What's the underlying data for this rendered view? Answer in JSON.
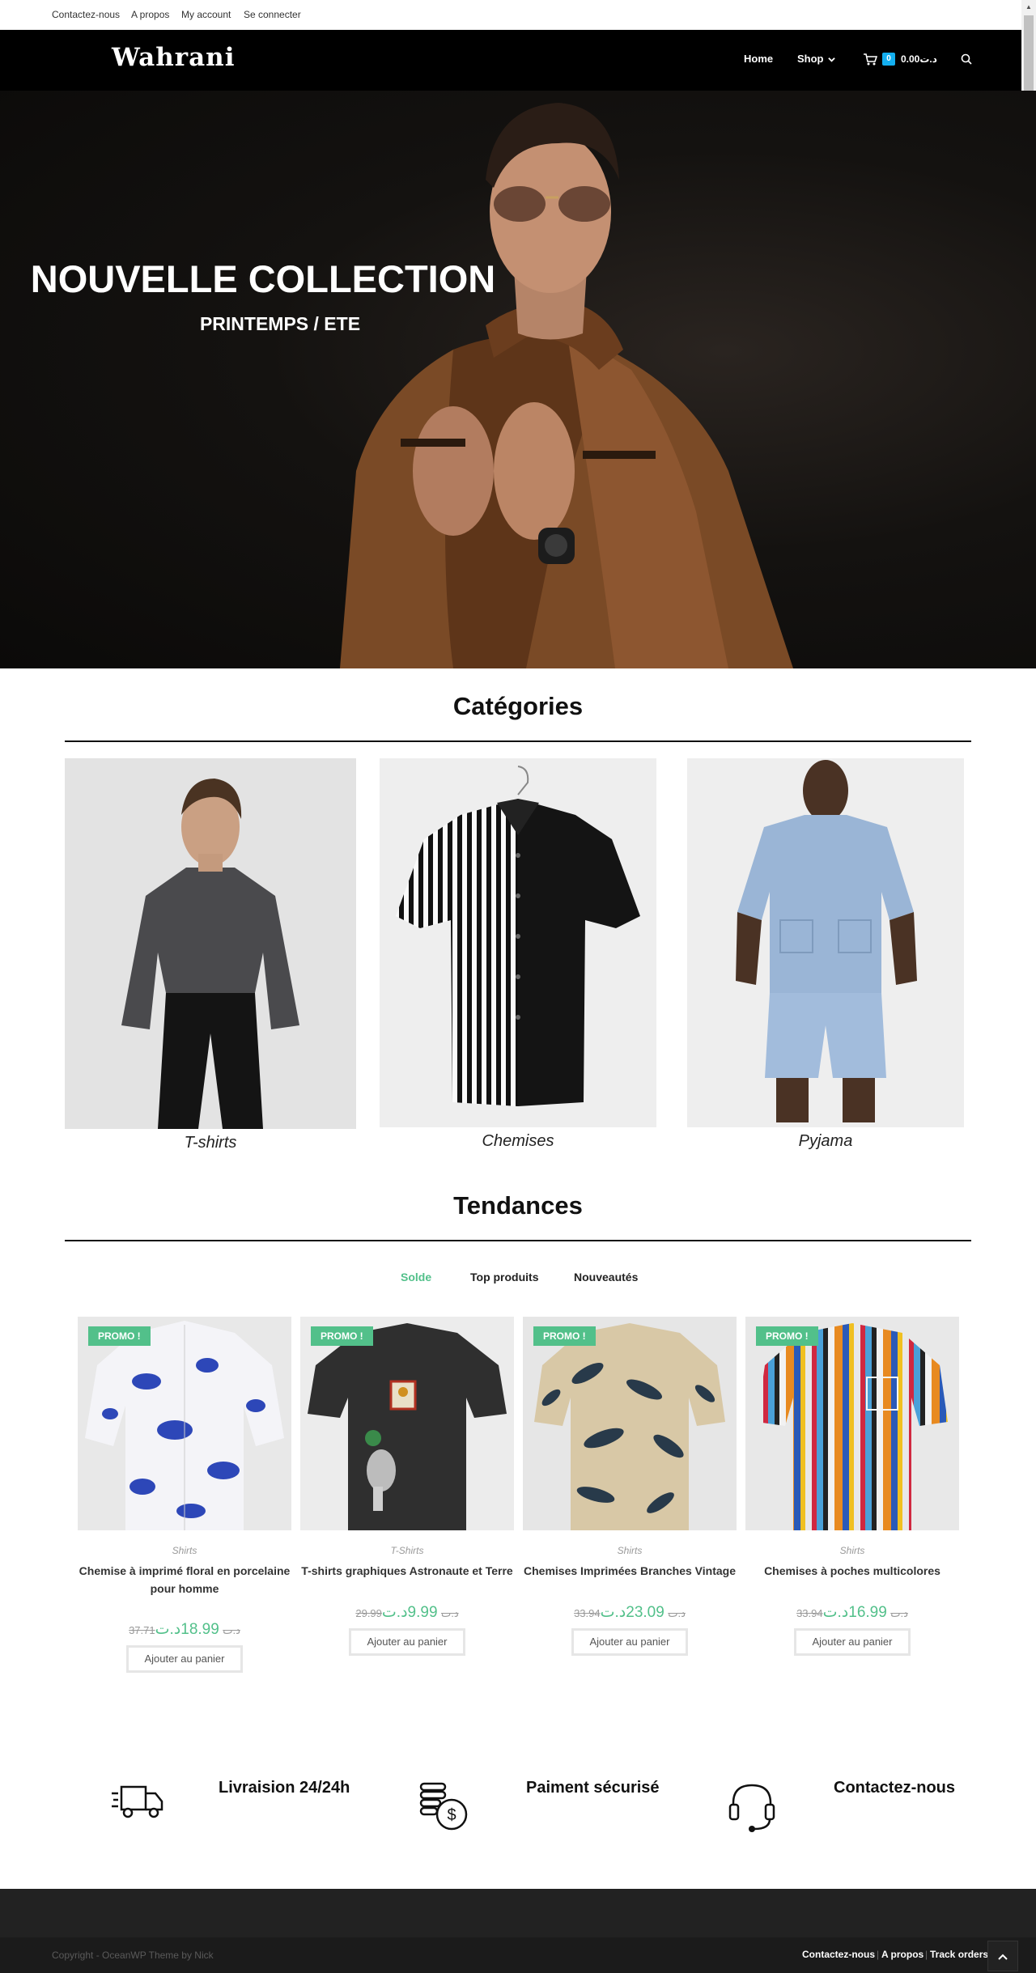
{
  "topbar": {
    "links": [
      "Contactez-nous",
      "A propos",
      "My account",
      "Se connecter"
    ]
  },
  "header": {
    "logo": "Wahrani",
    "nav": {
      "home": "Home",
      "shop": "Shop"
    },
    "cart_count": "0",
    "cart_total": "0.00د.ت"
  },
  "hero": {
    "title": "NOUVELLE COLLECTION",
    "subtitle": "PRINTEMPS / ETE"
  },
  "categories": {
    "title": "Catégories",
    "items": [
      "T-shirts",
      "Chemises",
      "Pyjama"
    ]
  },
  "trending": {
    "title": "Tendances",
    "tabs": [
      "Solde",
      "Top produits",
      "Nouveautés"
    ],
    "promo_label": "PROMO !",
    "add_label": "Ajouter au panier",
    "products": [
      {
        "category": "Shirts",
        "name": "Chemise à imprimé floral en porcelaine pour homme",
        "old_price": "37.71د.ت",
        "new_price": "18.99د.ت"
      },
      {
        "category": "T-Shirts",
        "name": "T-shirts graphiques Astronaute et Terre",
        "old_price": "29.99د.ت",
        "new_price": "9.99د.ت"
      },
      {
        "category": "Shirts",
        "name": "Chemises Imprimées Branches Vintage",
        "old_price": "33.94د.ت",
        "new_price": "23.09د.ت"
      },
      {
        "category": "Shirts",
        "name": "Chemises à poches multicolores",
        "old_price": "33.94د.ت",
        "new_price": "16.99د.ت"
      }
    ]
  },
  "features": [
    "Livraision 24/24h",
    "Paiment sécurisé",
    "Contactez-nous"
  ],
  "footer": {
    "copyright": "Copyright - OceanWP Theme by Nick",
    "links": [
      "Contactez-nous",
      "A propos",
      "Track orders"
    ]
  },
  "colors": {
    "accent": "#52c08a",
    "cart_badge": "#13aff0",
    "header_bg": "#000000"
  }
}
